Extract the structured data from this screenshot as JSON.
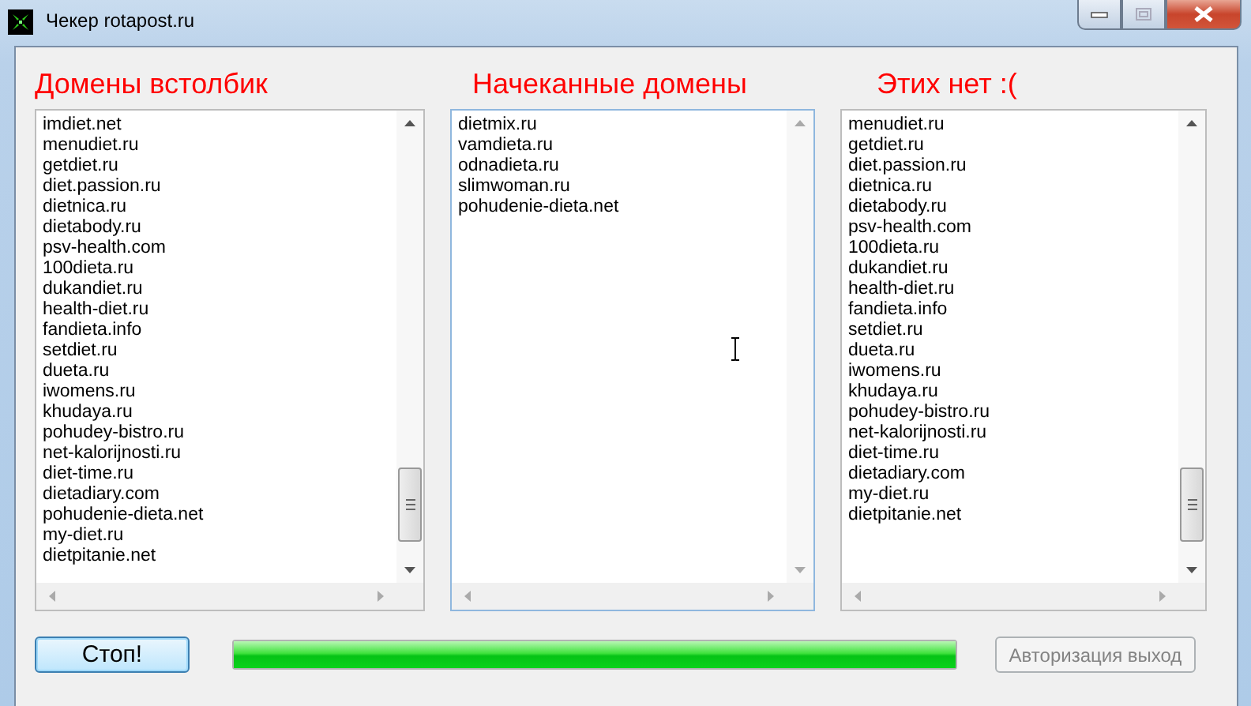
{
  "window": {
    "title": "Чекер rotapost.ru"
  },
  "panels": [
    {
      "heading": "Домены встолбик",
      "focused": false,
      "items": [
        "imdiet.net",
        "menudiet.ru",
        "getdiet.ru",
        "diet.passion.ru",
        "dietnica.ru",
        "dietabody.ru",
        "psv-health.com",
        "100dieta.ru",
        "dukandiet.ru",
        "health-diet.ru",
        "fandieta.info",
        "setdiet.ru",
        "dueta.ru",
        "iwomens.ru",
        "khudaya.ru",
        "pohudey-bistro.ru",
        "net-kalorijnosti.ru",
        "diet-time.ru",
        "dietadiary.com",
        "pohudenie-dieta.net",
        "my-diet.ru",
        "dietpitanie.net"
      ]
    },
    {
      "heading": "Начеканные домены",
      "focused": true,
      "items": [
        "dietmix.ru",
        "vamdieta.ru",
        "odnadieta.ru",
        "slimwoman.ru",
        "pohudenie-dieta.net"
      ]
    },
    {
      "heading": "Этих нет :(",
      "focused": false,
      "items": [
        "menudiet.ru",
        "getdiet.ru",
        "diet.passion.ru",
        "dietnica.ru",
        "dietabody.ru",
        "psv-health.com",
        "100dieta.ru",
        "dukandiet.ru",
        "health-diet.ru",
        "fandieta.info",
        "setdiet.ru",
        "dueta.ru",
        "iwomens.ru",
        "khudaya.ru",
        "pohudey-bistro.ru",
        "net-kalorijnosti.ru",
        "diet-time.ru",
        "dietadiary.com",
        "my-diet.ru",
        "dietpitanie.net"
      ]
    }
  ],
  "stop_button": {
    "label": "Стоп!",
    "default": true
  },
  "progress": {
    "level": 1
  },
  "auth_button": {
    "label": "Авторизация выход",
    "disabled": true
  }
}
